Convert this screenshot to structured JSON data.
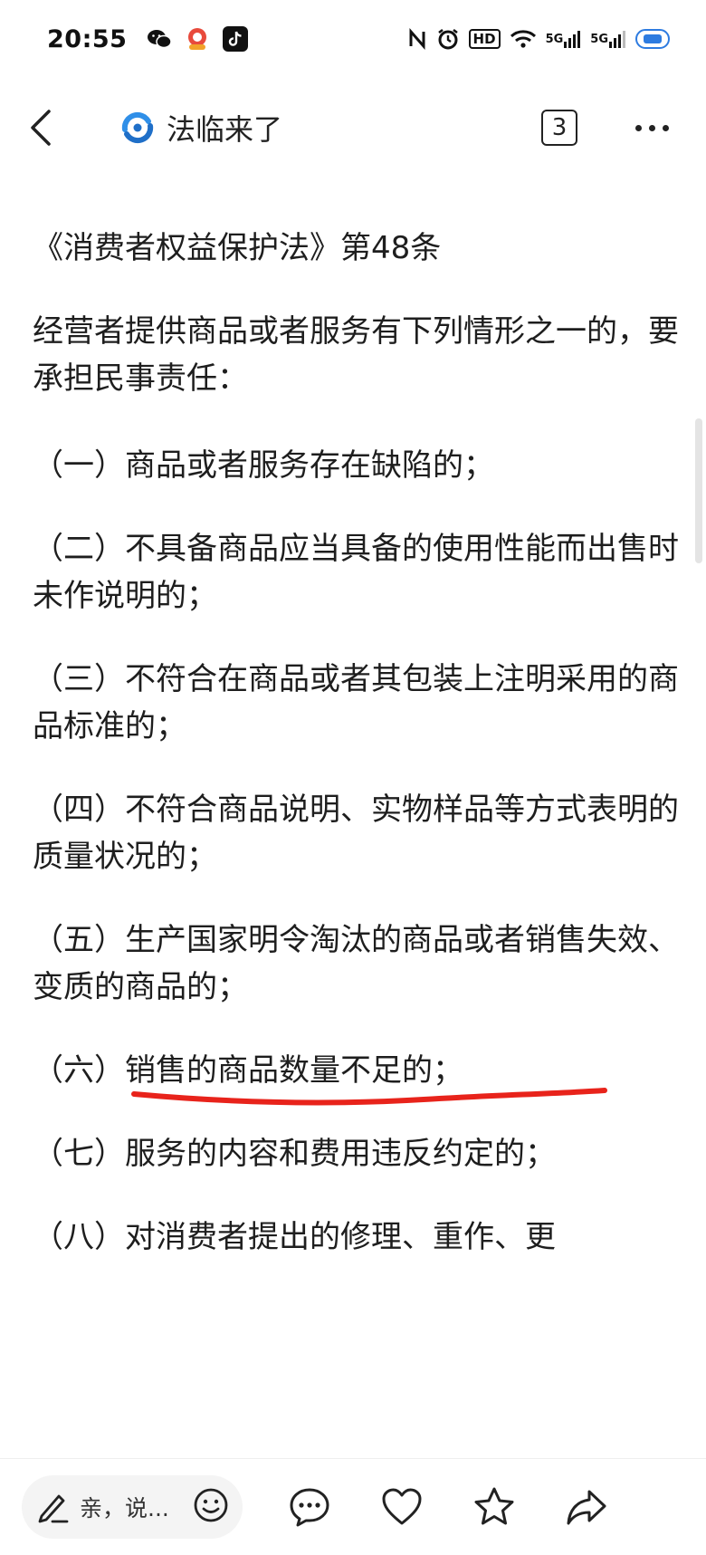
{
  "status": {
    "time": "20:55",
    "hd": "HD",
    "network1": "5G",
    "network2": "5G"
  },
  "header": {
    "channel_name": "法临来了",
    "count": "3"
  },
  "article": {
    "title": "《消费者权益保护法》第48条",
    "intro": "经营者提供商品或者服务有下列情形之一的，要承担民事责任：",
    "items": [
      "（一）商品或者服务存在缺陷的；",
      "（二）不具备商品应当具备的使用性能而出售时未作说明的；",
      "（三）不符合在商品或者其包装上注明采用的商品标准的；",
      "（四）不符合商品说明、实物样品等方式表明的质量状况的；",
      "（五）生产国家明令淘汰的商品或者销售失效、变质的商品的；"
    ],
    "item6_prefix": "（六）",
    "item6_text": "销售的商品数量不足的；",
    "item7": "（七）服务的内容和费用违反约定的；",
    "item8": "（八）对消费者提出的修理、重作、更"
  },
  "colors": {
    "underline": "#e8231b",
    "text": "#1e1e1e",
    "battery": "#2d7be0"
  },
  "bottom_bar": {
    "comment_placeholder": "亲，说...",
    "icons": [
      "pencil-icon",
      "smiley-icon",
      "comment-icon",
      "heart-icon",
      "star-icon",
      "share-icon"
    ]
  }
}
